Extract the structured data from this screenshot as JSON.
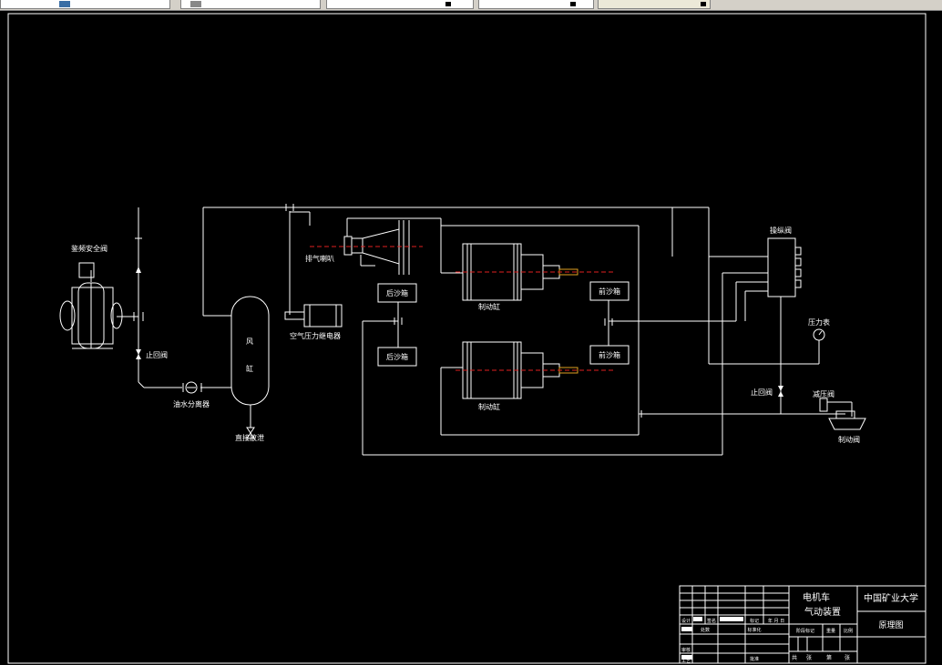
{
  "toolbar": {
    "fields": [
      "",
      "",
      "",
      "",
      ""
    ],
    "icons": [
      "layer-icon",
      "bylayer-color-icon",
      "bylayer-linetype-icon",
      "bylayer-lineweight-icon",
      "plot-style-icon"
    ]
  },
  "labels": {
    "compressor_safety_valve": "鉴频安全阀",
    "check_valve_left": "止回阀",
    "oil_water_separator": "油水分离器",
    "reservoir_line1": "风",
    "reservoir_line2": "缸",
    "drain_valve": "直接放泄",
    "horn": "排气喇叭",
    "pressure_relay": "空气压力继电器",
    "rear_sand_box_top": "后沙箱",
    "rear_sand_box_bottom": "后沙箱",
    "brake_cylinder_top": "制动缸",
    "brake_cylinder_bottom": "制动缸",
    "front_sand_box_top": "前沙箱",
    "front_sand_box_bottom": "前沙箱",
    "control_valve": "操纵阀",
    "pressure_gauge": "压力表",
    "check_valve_right": "止回阀",
    "reducing_valve": "减压阀",
    "brake_valve": "制动阀"
  },
  "title_block": {
    "drawing_title_line1": "电机车",
    "drawing_title_line2": "气动装置",
    "school": "中国矿业大学",
    "drawing_type": "原理图",
    "row_design": "设计",
    "row_standard": "标准化",
    "row_sign": "签名",
    "row_date": "年 月 日",
    "row_mark": "标记",
    "row_count": "处数",
    "row_review": "审核",
    "row_craft": "工艺",
    "row_approve": "批准",
    "stage_mark": "阶段标记",
    "weight": "重量",
    "scale": "比例",
    "total_sheets": "共",
    "sheet_word": "张",
    "page_word": "第",
    "sheet_word2": "张"
  },
  "colors": {
    "background": "#000000",
    "lines": "#ffffff",
    "centerline": "#e02020",
    "piston_rod": "#e0a020"
  }
}
